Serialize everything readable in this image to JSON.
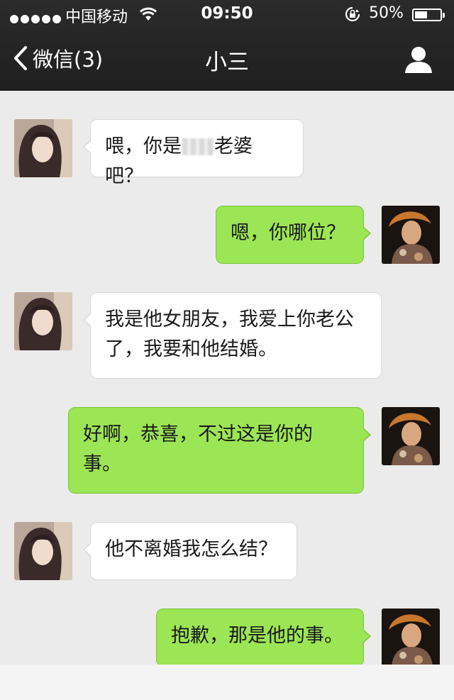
{
  "status_bar": {
    "carrier": "中国移动",
    "time": "09:50",
    "battery_percent": "50%",
    "battery_level": 0.5,
    "icons": [
      "signal-dots-icon",
      "wifi-icon",
      "rotation-lock-icon",
      "battery-icon"
    ]
  },
  "nav": {
    "back_label": "微信(3)",
    "title": "小三",
    "profile_icon": "person-icon"
  },
  "messages": [
    {
      "side": "left",
      "sender": "other",
      "text_before": "喂，你是",
      "redacted": true,
      "text_after": "老婆吧？"
    },
    {
      "side": "right",
      "sender": "me",
      "text": "嗯，你哪位？"
    },
    {
      "side": "left",
      "sender": "other",
      "text": "我是他女朋友，我爱上你老公了，我要和他结婚。"
    },
    {
      "side": "right",
      "sender": "me",
      "text": "好啊，恭喜，不过这是你的事。"
    },
    {
      "side": "left",
      "sender": "other",
      "text": "他不离婚我怎么结？"
    },
    {
      "side": "right",
      "sender": "me",
      "text": "抱歉，那是他的事。"
    }
  ],
  "colors": {
    "bar": "#262626",
    "chat_bg": "#ebebeb",
    "bubble_me": "#9ce554",
    "bubble_other": "#ffffff"
  }
}
